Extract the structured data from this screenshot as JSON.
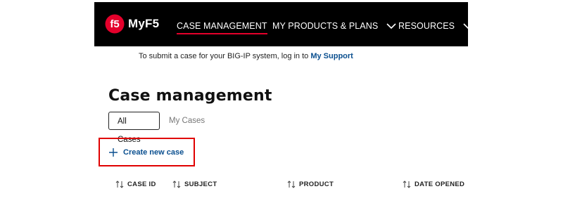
{
  "brand": {
    "name": "MyF5",
    "logo_text": "f5",
    "accent_color": "#e4002b"
  },
  "nav": {
    "items": [
      {
        "label": "CASE MANAGEMENT",
        "active": true
      },
      {
        "label": "MY PRODUCTS & PLANS",
        "icon": "chevron-down-icon"
      },
      {
        "label": "RESOURCES",
        "icon": "chevron-down-icon"
      }
    ]
  },
  "notice": {
    "text": "To submit a case for your BIG-IP system, log in to ",
    "link": "My Support"
  },
  "page": {
    "title": "Case management"
  },
  "tabs": [
    {
      "label": "All Cases",
      "active": true
    },
    {
      "label": "My Cases",
      "active": false
    }
  ],
  "actions": {
    "create_label": "Create new case",
    "create_icon": "plus-icon"
  },
  "table": {
    "columns": [
      {
        "label": "CASE ID",
        "sortable": true
      },
      {
        "label": "SUBJECT",
        "sortable": true
      },
      {
        "label": "PRODUCT",
        "sortable": true
      },
      {
        "label": "DATE OPENED",
        "sortable": true
      }
    ]
  }
}
